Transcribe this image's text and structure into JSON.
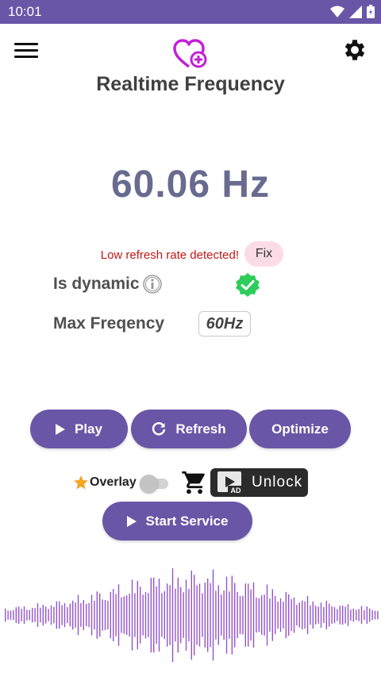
{
  "status_bar": {
    "time": "10:01"
  },
  "header": {
    "title": "Realtime Frequency"
  },
  "main": {
    "frequency": "60.06 Hz",
    "warning": "Low refresh rate detected!",
    "fix_label": "Fix",
    "dynamic_label": "Is dynamic",
    "max_label": "Max Freqency",
    "max_value": "60Hz"
  },
  "actions": {
    "play_label": "Play",
    "refresh_label": "Refresh",
    "optimize_label": "Optimize"
  },
  "overlay": {
    "label": "Overlay",
    "enabled": false,
    "unlock_label": "Unlock",
    "ad_badge": "AD"
  },
  "service": {
    "start_label": "Start Service"
  },
  "colors": {
    "primary": "#6a56a6",
    "warning": "#c01818",
    "fix_bg": "#fbdce6",
    "frequency": "#686b8f",
    "check": "#2ecc5a",
    "logo": "#c21fd8",
    "wave_start": "#2aa0e0",
    "wave_mid": "#9b3fe0",
    "wave_end": "#e8389a"
  },
  "icons": [
    "menu-icon",
    "heart-plus-icon",
    "gear-icon",
    "info-icon",
    "verified-check-icon",
    "play-icon",
    "refresh-icon",
    "star-icon",
    "cart-icon",
    "ad-video-icon"
  ]
}
